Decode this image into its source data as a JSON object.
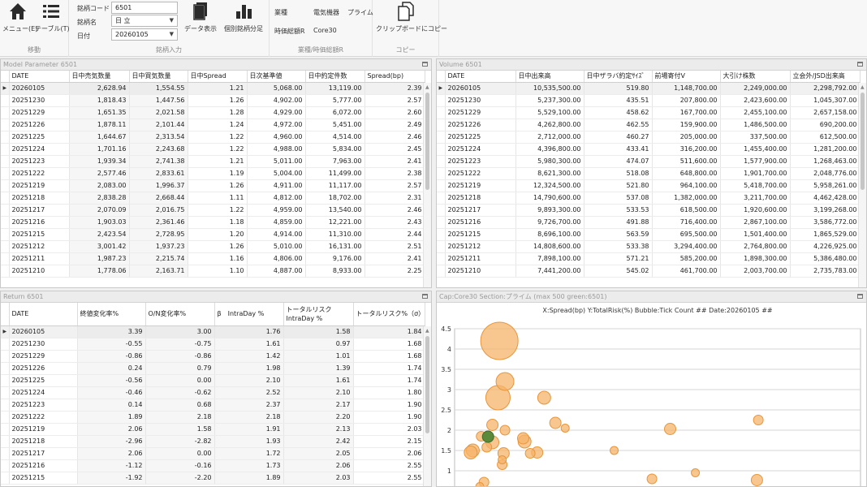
{
  "ribbon": {
    "menu_label": "メニュー(E)",
    "table_label": "テーブル(T)",
    "move_caption": "移動",
    "code_label": "銘柄コード",
    "code_value": "6501",
    "name_label": "銘柄名",
    "name_value": "日 立",
    "date_label": "日付",
    "date_value": "20260105",
    "data_label": "データ表示",
    "individual_label": "個別銘柄分足",
    "input_caption": "銘柄入力",
    "sector_label": "業種",
    "sector_value": "電気機器",
    "market_value": "プライム",
    "cap_label": "時価総額R",
    "cap_value": "Core30",
    "sector_caption": "業種/時価総額R",
    "copy_label": "クリップボードにコピー",
    "copy_caption": "コピー"
  },
  "model": {
    "title": "Model Parameter 6501",
    "headers": [
      "DATE",
      "日中売気数量",
      "日中買気数量",
      "日中Spread",
      "日次基準値",
      "日中約定件数",
      "Spread(bp)"
    ],
    "rows": [
      [
        "20260105",
        "2,628.94",
        "1,554.55",
        "1.21",
        "5,068.00",
        "13,119.00",
        "2.39"
      ],
      [
        "20251230",
        "1,818.43",
        "1,447.56",
        "1.26",
        "4,902.00",
        "5,777.00",
        "2.57"
      ],
      [
        "20251229",
        "1,651.35",
        "2,021.58",
        "1.28",
        "4,929.00",
        "6,072.00",
        "2.60"
      ],
      [
        "20251226",
        "1,878.11",
        "2,101.44",
        "1.24",
        "4,972.00",
        "5,451.00",
        "2.49"
      ],
      [
        "20251225",
        "1,644.67",
        "2,313.54",
        "1.22",
        "4,960.00",
        "4,514.00",
        "2.46"
      ],
      [
        "20251224",
        "1,701.16",
        "2,243.68",
        "1.22",
        "4,988.00",
        "5,834.00",
        "2.45"
      ],
      [
        "20251223",
        "1,939.34",
        "2,741.38",
        "1.21",
        "5,011.00",
        "7,963.00",
        "2.41"
      ],
      [
        "20251222",
        "2,577.46",
        "2,833.61",
        "1.19",
        "5,004.00",
        "11,499.00",
        "2.38"
      ],
      [
        "20251219",
        "2,083.00",
        "1,996.37",
        "1.26",
        "4,911.00",
        "11,117.00",
        "2.57"
      ],
      [
        "20251218",
        "2,838.28",
        "2,668.44",
        "1.11",
        "4,812.00",
        "18,702.00",
        "2.31"
      ],
      [
        "20251217",
        "2,070.09",
        "2,016.75",
        "1.22",
        "4,959.00",
        "13,540.00",
        "2.46"
      ],
      [
        "20251216",
        "1,903.03",
        "2,361.46",
        "1.18",
        "4,859.00",
        "12,221.00",
        "2.43"
      ],
      [
        "20251215",
        "2,423.54",
        "2,728.95",
        "1.20",
        "4,914.00",
        "11,310.00",
        "2.44"
      ],
      [
        "20251212",
        "3,001.42",
        "1,937.23",
        "1.26",
        "5,010.00",
        "16,131.00",
        "2.51"
      ],
      [
        "20251211",
        "1,987.23",
        "2,215.74",
        "1.16",
        "4,806.00",
        "9,176.00",
        "2.41"
      ],
      [
        "20251210",
        "1,778.06",
        "2,163.71",
        "1.10",
        "4,887.00",
        "8,933.00",
        "2.25"
      ]
    ]
  },
  "volume": {
    "title": "Volume 6501",
    "headers": [
      "DATE",
      "日中出来高",
      "日中ザラバ約定ｻｲｽﾞ",
      "前場寄付V",
      "大引け株数",
      "立会外/JSD出来高"
    ],
    "rows": [
      [
        "20260105",
        "10,535,500.00",
        "519.80",
        "1,148,700.00",
        "2,249,000.00",
        "2,298,792.00"
      ],
      [
        "20251230",
        "5,237,300.00",
        "435.51",
        "207,800.00",
        "2,423,600.00",
        "1,045,307.00"
      ],
      [
        "20251229",
        "5,529,100.00",
        "458.62",
        "167,700.00",
        "2,455,100.00",
        "2,657,158.00"
      ],
      [
        "20251226",
        "4,262,800.00",
        "462.55",
        "159,900.00",
        "1,486,500.00",
        "690,200.00"
      ],
      [
        "20251225",
        "2,712,000.00",
        "460.27",
        "205,000.00",
        "337,500.00",
        "612,500.00"
      ],
      [
        "20251224",
        "4,396,800.00",
        "433.41",
        "316,200.00",
        "1,455,400.00",
        "1,281,200.00"
      ],
      [
        "20251223",
        "5,980,300.00",
        "474.07",
        "511,600.00",
        "1,577,900.00",
        "1,268,463.00"
      ],
      [
        "20251222",
        "8,621,300.00",
        "518.08",
        "648,800.00",
        "1,901,700.00",
        "2,048,776.00"
      ],
      [
        "20251219",
        "12,324,500.00",
        "521.80",
        "964,100.00",
        "5,418,700.00",
        "5,958,261.00"
      ],
      [
        "20251218",
        "14,790,600.00",
        "537.08",
        "1,382,000.00",
        "3,211,700.00",
        "4,462,428.00"
      ],
      [
        "20251217",
        "9,893,300.00",
        "533.53",
        "618,500.00",
        "1,920,600.00",
        "3,199,268.00"
      ],
      [
        "20251216",
        "9,726,700.00",
        "491.88",
        "716,400.00",
        "2,867,100.00",
        "3,586,772.00"
      ],
      [
        "20251215",
        "8,696,100.00",
        "563.59",
        "695,500.00",
        "1,501,400.00",
        "1,865,529.00"
      ],
      [
        "20251212",
        "14,808,600.00",
        "533.38",
        "3,294,400.00",
        "2,764,800.00",
        "4,226,925.00"
      ],
      [
        "20251211",
        "7,898,100.00",
        "571.21",
        "585,200.00",
        "1,898,300.00",
        "5,386,480.00"
      ],
      [
        "20251210",
        "7,441,200.00",
        "545.02",
        "461,700.00",
        "2,003,700.00",
        "2,735,783.00"
      ]
    ]
  },
  "returns": {
    "title": "Return 6501",
    "headers": [
      "DATE",
      "終値変化率%",
      "O/N変化率%",
      "β　IntraDay %",
      "トータルリスク IntraDay %",
      "トータルリスク%（σ）"
    ],
    "rows": [
      [
        "20260105",
        "3.39",
        "3.00",
        "1.76",
        "1.58",
        "1.84"
      ],
      [
        "20251230",
        "-0.55",
        "-0.75",
        "1.61",
        "0.97",
        "1.68"
      ],
      [
        "20251229",
        "-0.86",
        "-0.86",
        "1.42",
        "1.01",
        "1.68"
      ],
      [
        "20251226",
        "0.24",
        "0.79",
        "1.98",
        "1.39",
        "1.74"
      ],
      [
        "20251225",
        "-0.56",
        "0.00",
        "2.10",
        "1.61",
        "1.74"
      ],
      [
        "20251224",
        "-0.46",
        "-0.62",
        "2.52",
        "2.10",
        "1.80"
      ],
      [
        "20251223",
        "0.14",
        "0.68",
        "2.37",
        "2.17",
        "1.90"
      ],
      [
        "20251222",
        "1.89",
        "2.18",
        "2.18",
        "2.20",
        "1.90"
      ],
      [
        "20251219",
        "2.06",
        "1.58",
        "1.91",
        "2.13",
        "2.03"
      ],
      [
        "20251218",
        "-2.96",
        "-2.82",
        "1.93",
        "2.42",
        "2.15"
      ],
      [
        "20251217",
        "2.06",
        "0.00",
        "1.72",
        "2.05",
        "2.06"
      ],
      [
        "20251216",
        "-1.12",
        "-0.16",
        "1.73",
        "2.06",
        "2.55"
      ],
      [
        "20251215",
        "-1.92",
        "-2.20",
        "1.89",
        "2.03",
        "2.55"
      ]
    ]
  },
  "chart_panel_title": "Cap:Core30 Section:プライム (max 500 green:6501)",
  "chart_data": {
    "type": "scatter",
    "title": "X:Spread(bp) Y:TotalRisk(%) Bubble:Tick Count  ## Date:20260105 ##",
    "ylim": [
      0.5,
      4.5
    ],
    "yticks": [
      0.5,
      1,
      1.5,
      2,
      2.5,
      3,
      3.5,
      4,
      4.5
    ],
    "xlim": [
      0,
      29
    ],
    "grid": true,
    "colors": {
      "bubble": "#f6b36a",
      "bubble_edge": "#e8963a",
      "highlight": "#5b8a3a",
      "highlight_edge": "#3f6b25"
    },
    "points": [
      {
        "x": 3.2,
        "y": 4.2,
        "s": 23
      },
      {
        "x": 3.6,
        "y": 3.2,
        "s": 11
      },
      {
        "x": 3.1,
        "y": 2.8,
        "s": 15
      },
      {
        "x": 6.4,
        "y": 2.8,
        "s": 8
      },
      {
        "x": 7.2,
        "y": 2.18,
        "s": 7
      },
      {
        "x": 7.9,
        "y": 2.05,
        "s": 5
      },
      {
        "x": 2.7,
        "y": 2.13,
        "s": 7
      },
      {
        "x": 3.6,
        "y": 2.0,
        "s": 6
      },
      {
        "x": 1.9,
        "y": 1.85,
        "s": 6
      },
      {
        "x": 4.9,
        "y": 1.8,
        "s": 7
      },
      {
        "x": 5.0,
        "y": 1.72,
        "s": 8
      },
      {
        "x": 2.7,
        "y": 1.7,
        "s": 8
      },
      {
        "x": 2.3,
        "y": 1.58,
        "s": 6
      },
      {
        "x": 1.3,
        "y": 1.5,
        "s": 8
      },
      {
        "x": 1.15,
        "y": 1.45,
        "s": 8
      },
      {
        "x": 3.5,
        "y": 1.43,
        "s": 7
      },
      {
        "x": 5.9,
        "y": 1.45,
        "s": 7
      },
      {
        "x": 5.4,
        "y": 1.43,
        "s": 6
      },
      {
        "x": 3.4,
        "y": 1.27,
        "s": 5
      },
      {
        "x": 3.4,
        "y": 1.15,
        "s": 6
      },
      {
        "x": 11.4,
        "y": 1.5,
        "s": 5
      },
      {
        "x": 15.4,
        "y": 2.03,
        "s": 7
      },
      {
        "x": 21.7,
        "y": 2.25,
        "s": 6
      },
      {
        "x": 14.1,
        "y": 0.8,
        "s": 6
      },
      {
        "x": 17.2,
        "y": 0.95,
        "s": 5
      },
      {
        "x": 21.6,
        "y": 0.77,
        "s": 7
      },
      {
        "x": 2.1,
        "y": 0.72,
        "s": 6
      },
      {
        "x": 1.8,
        "y": 0.61,
        "s": 5
      },
      {
        "x": 2.39,
        "y": 1.84,
        "s": 7,
        "highlight": true
      }
    ]
  }
}
